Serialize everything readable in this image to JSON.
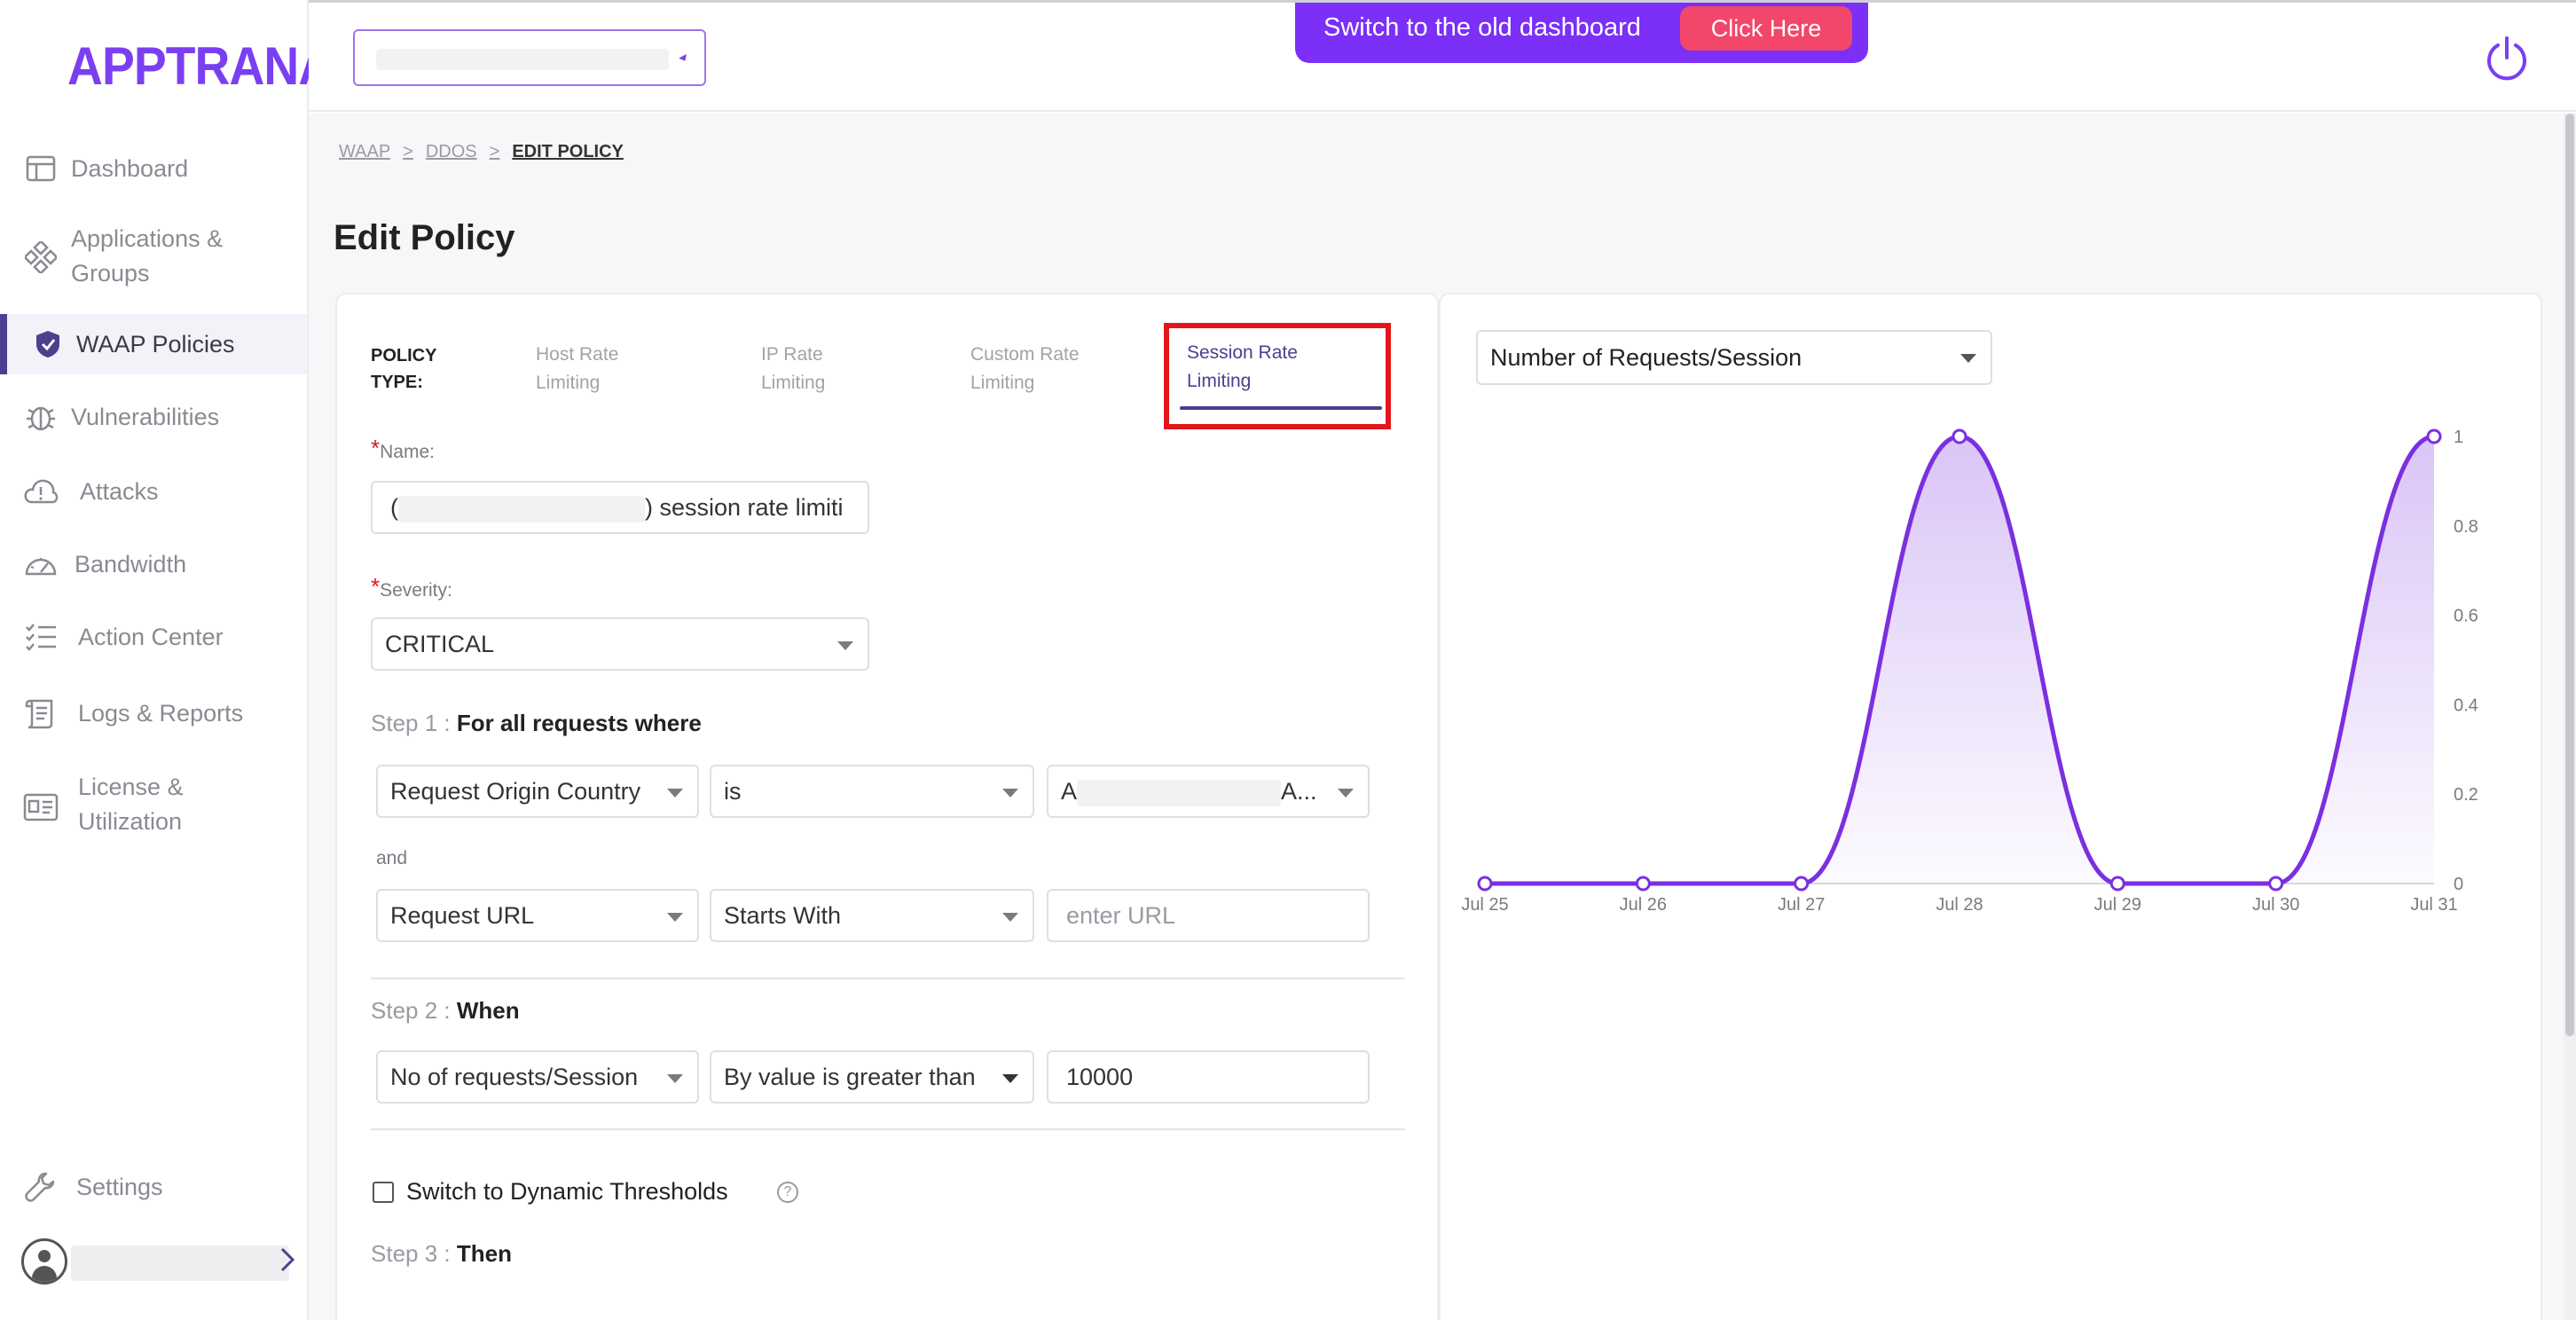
{
  "app": {
    "logo": "APPTRANA",
    "banner_text": "Switch to the old dashboard",
    "banner_button": "Click Here",
    "brand_color": "#7b3ff2"
  },
  "sidebar": {
    "items": [
      {
        "label": "Dashboard",
        "icon": "layout-icon"
      },
      {
        "label": "Applications &\nGroups",
        "icon": "apps-icon"
      },
      {
        "label": "WAAP Policies",
        "icon": "shield-icon"
      },
      {
        "label": "Vulnerabilities",
        "icon": "bug-icon"
      },
      {
        "label": "Attacks",
        "icon": "alert-cloud-icon"
      },
      {
        "label": "Bandwidth",
        "icon": "speedometer-icon"
      },
      {
        "label": "Action Center",
        "icon": "checklist-icon"
      },
      {
        "label": "Logs & Reports",
        "icon": "scroll-icon"
      },
      {
        "label": "License &\nUtilization",
        "icon": "license-icon"
      },
      {
        "label": "Settings",
        "icon": "wrench-icon"
      }
    ]
  },
  "breadcrumb": [
    "WAAP",
    "DDOS",
    "EDIT POLICY"
  ],
  "breadcrumb_sep": ">",
  "page_title": "Edit Policy",
  "policy": {
    "type_label": "POLICY\nTYPE:",
    "tabs": [
      "Host Rate\nLimiting",
      "IP Rate\nLimiting",
      "Custom Rate\nLimiting",
      "Session Rate\nLimiting"
    ],
    "active_tab": "Session Rate\nLimiting",
    "name_label": "Name:",
    "name_value_prefix": "(",
    "name_value_suffix": ") session rate limiti",
    "severity_label": "Severity:",
    "severity_value": "CRITICAL",
    "step1_prefix": "Step 1 :",
    "step1_title": "For all requests where",
    "cond1": {
      "field": "Request Origin Country",
      "op": "is",
      "value_prefix": "A",
      "value_suffix": "A..."
    },
    "and_label": "and",
    "cond2": {
      "field": "Request URL",
      "op": "Starts With",
      "placeholder": "enter URL"
    },
    "step2_prefix": "Step 2 :",
    "step2_title": "When",
    "cond3": {
      "field": "No of requests/Session",
      "op": "By value is greater than",
      "value": "10000"
    },
    "dynamic_label": "Switch to Dynamic Thresholds",
    "help_glyph": "?",
    "step3_prefix": "Step 3 :",
    "step3_title": "Then",
    "required_mark": "*"
  },
  "chart_data": {
    "type": "area",
    "metric_select": "Number of Requests/Session",
    "x": [
      "Jul 25",
      "Jul 26",
      "Jul 27",
      "Jul 28",
      "Jul 29",
      "Jul 30",
      "Jul 31"
    ],
    "values": [
      0,
      0,
      0,
      1,
      0,
      0,
      1
    ],
    "ylim": [
      0,
      1
    ],
    "yticks": [
      "0",
      "0.2",
      "0.4",
      "0.6",
      "0.8",
      "1"
    ],
    "y_axis_side": "right",
    "line_color": "#7b2fe0",
    "grid": false
  }
}
